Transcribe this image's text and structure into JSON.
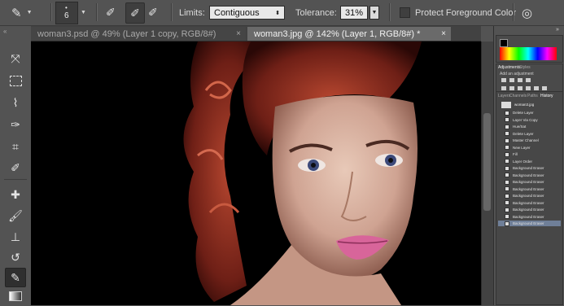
{
  "options_bar": {
    "brush_size": "6",
    "limits_label": "Limits:",
    "limits_value": "Contiguous",
    "tolerance_label": "Tolerance:",
    "tolerance_value": "31%",
    "protect_label": "Protect Foreground Color"
  },
  "tabs": [
    {
      "label": "woman3.psd @ 49% (Layer 1 copy, RGB/8#)",
      "close": "×"
    },
    {
      "label": "woman3.jpg @ 142% (Layer 1, RGB/8#) *",
      "close": "×"
    }
  ],
  "panels": {
    "top_tabs": [
      "Adjustments",
      "Styles"
    ],
    "adjust_title": "Add an adjustment",
    "lower_tabs": [
      "Layers",
      "Channels",
      "Paths",
      "History"
    ],
    "history_snapshot": "woman3.jpg",
    "history_items": [
      "Delete Layer",
      "Layer Via Copy",
      "Hue/Sat",
      "Delete Layer",
      "Master Channel",
      "New Layer",
      "Fill",
      "Layer Order",
      "Background Eraser",
      "Background Eraser",
      "Background Eraser",
      "Background Eraser",
      "Background Eraser",
      "Background Eraser",
      "Background Eraser",
      "Background Eraser",
      "Background Eraser"
    ]
  },
  "colors": {
    "app_bg": "#535353",
    "canvas_bg": "#000000",
    "active_tab": "#6a6a6a",
    "history_selected": "#6f7f98"
  }
}
